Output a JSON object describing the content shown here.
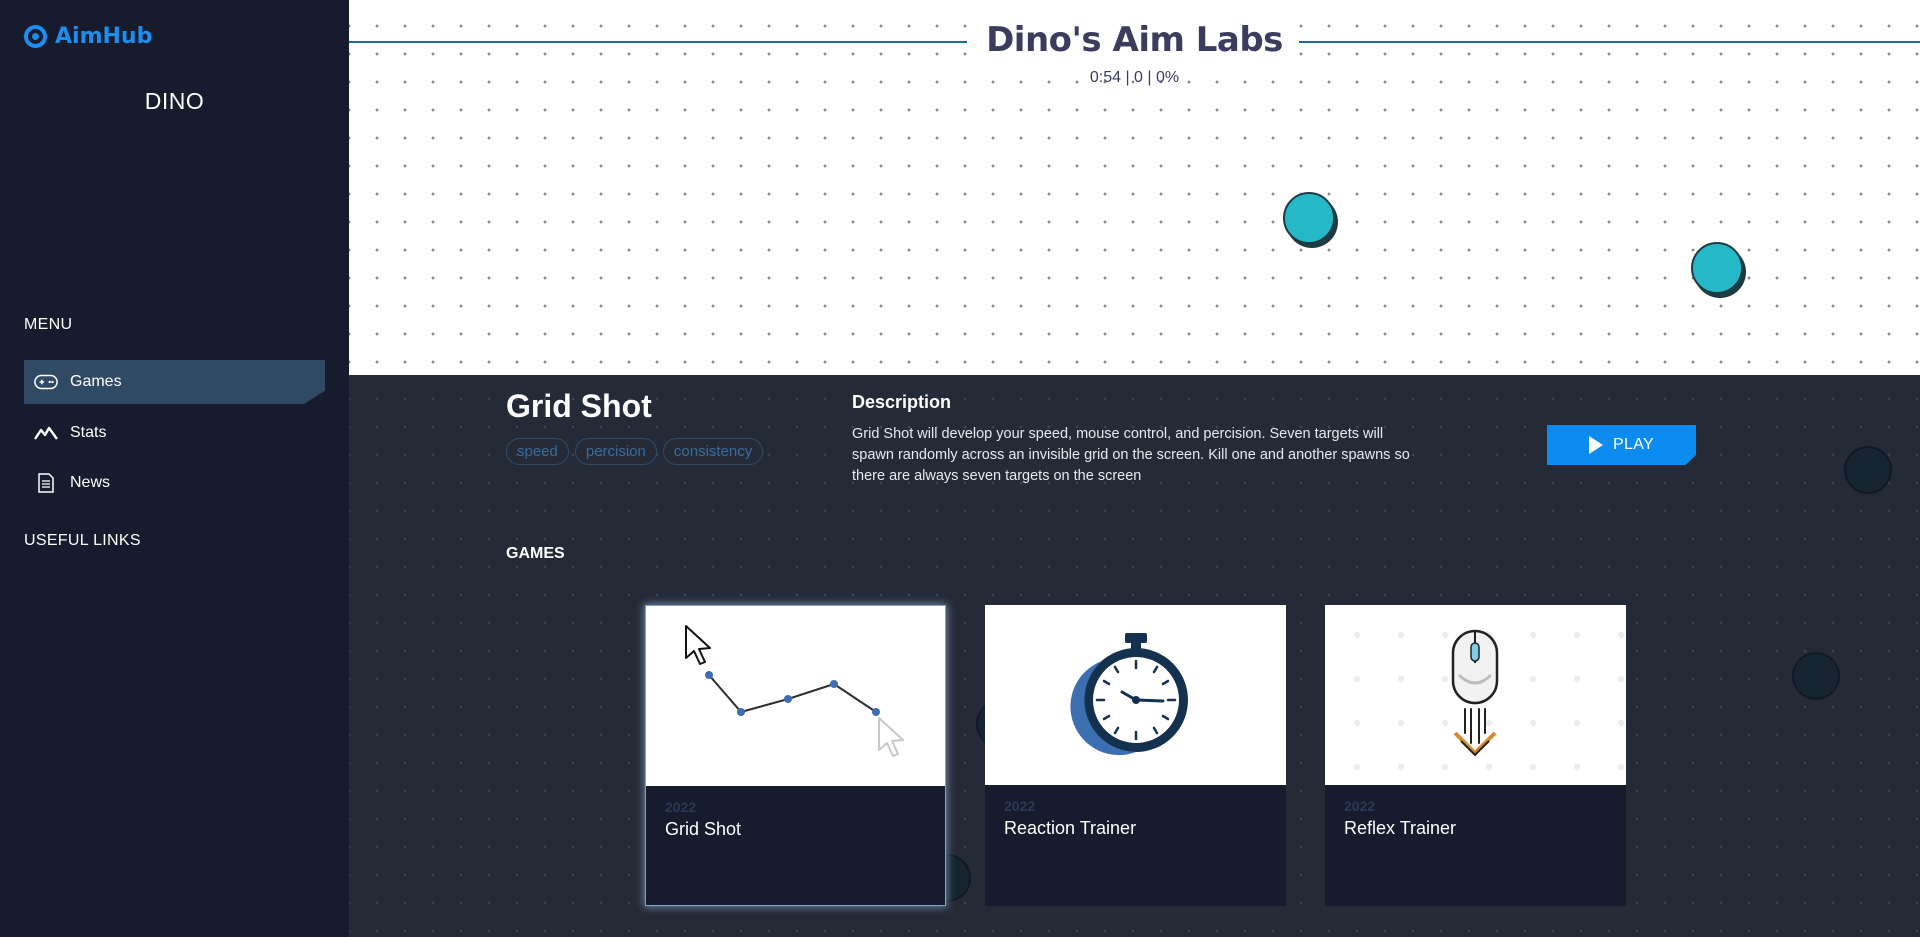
{
  "brand": {
    "name": "AimHub",
    "color": "#1b8fef"
  },
  "user": {
    "name": "DINO"
  },
  "sidebar": {
    "menu_title": "MENU",
    "items": [
      {
        "label": "Games",
        "icon": "gamepad-icon",
        "active": true
      },
      {
        "label": "Stats",
        "icon": "chart-peaks-icon",
        "active": false
      },
      {
        "label": "News",
        "icon": "document-icon",
        "active": false
      }
    ],
    "links_title": "USEFUL LINKS"
  },
  "game": {
    "title": "Dino's Aim Labs",
    "stats": "0:54 | 0 | 0%",
    "target_color": "#25b9c8"
  },
  "mode": {
    "title": "Grid Shot",
    "tags": [
      "speed",
      "percision",
      "consistency"
    ],
    "description_heading": "Description",
    "description": "Grid Shot will develop your speed, mouse control, and percision. Seven targets will spawn randomly across an invisible grid on the screen. Kill one and another spawns so there are always seven targets on the screen",
    "play_label": "PLAY",
    "accent": "#0c8cf1"
  },
  "games_section": {
    "heading": "GAMES",
    "cards": [
      {
        "year": "2022",
        "name": "Grid Shot",
        "icon": "cursor-path-icon",
        "selected": true
      },
      {
        "year": "2022",
        "name": "Reaction Trainer",
        "icon": "stopwatch-icon",
        "selected": false
      },
      {
        "year": "2022",
        "name": "Reflex Trainer",
        "icon": "mouse-rocket-icon",
        "selected": false
      }
    ]
  }
}
